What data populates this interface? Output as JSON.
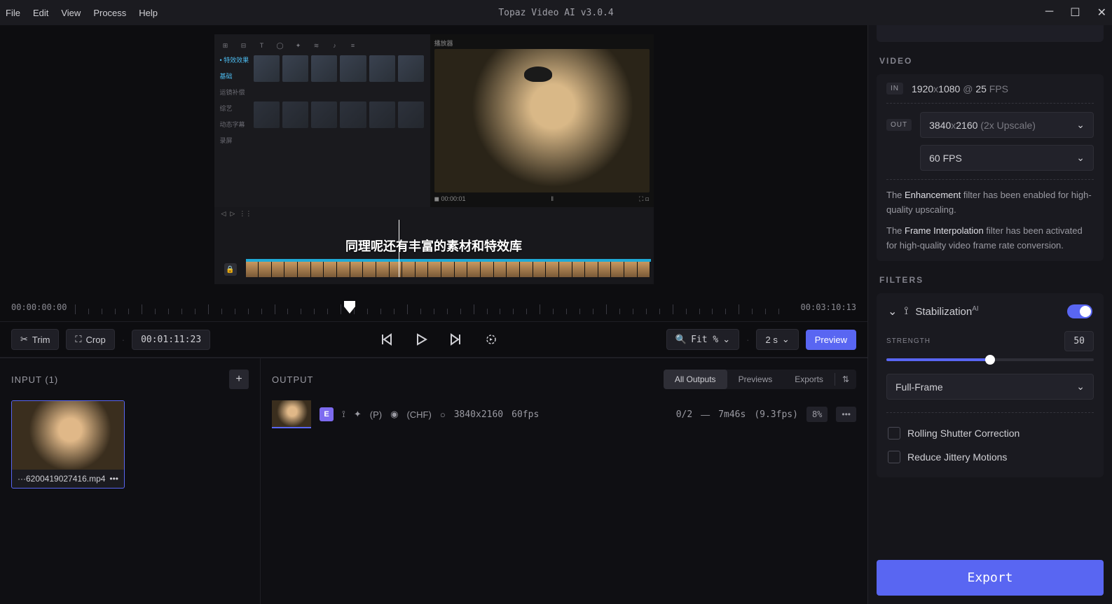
{
  "app": {
    "title": "Topaz Video AI  v3.0.4"
  },
  "menu": [
    "File",
    "Edit",
    "View",
    "Process",
    "Help"
  ],
  "preview": {
    "subtitle": "同理呢还有丰富的素材和特效库"
  },
  "timeline": {
    "start": "00:00:00:00",
    "end": "00:03:10:13",
    "current": "00:01:11:23"
  },
  "toolbar": {
    "trim": "Trim",
    "crop": "Crop",
    "fit": "Fit %",
    "speed": "2 s",
    "preview": "Preview"
  },
  "inputs": {
    "header": "INPUT (1)",
    "file": "···6200419027416.mp4"
  },
  "outputs": {
    "header": "OUTPUT",
    "tabs": [
      "All Outputs",
      "Previews",
      "Exports"
    ],
    "row": {
      "badge": "E",
      "p": "(P)",
      "chf": "(CHF)",
      "res": "3840x2160",
      "fps": "60fps",
      "prog": "0/2",
      "dash": "—",
      "time": "7m46s",
      "rate": "(9.3fps)",
      "pct": "8%"
    }
  },
  "video": {
    "header": "VIDEO",
    "in_tag": "IN",
    "in_res_w": "1920",
    "in_res_sep": "x",
    "in_res_h": "1080",
    "at": "@",
    "in_fps": "25",
    "fps_unit": "FPS",
    "out_tag": "OUT",
    "out_res_w": "3840",
    "out_res_h": "2160",
    "out_scale": "(2x Upscale)",
    "out_fps": "60 FPS",
    "info1_pre": "The ",
    "info1_b": "Enhancement",
    "info1_post": " filter has been enabled for high-quality upscaling.",
    "info2_pre": "The ",
    "info2_b": "Frame Interpolation",
    "info2_post": " filter has been activated for high-quality video frame rate conversion."
  },
  "filters": {
    "header": "FILTERS",
    "stab": "Stabilization",
    "ai": "AI",
    "strength_label": "STRENGTH",
    "strength": "50",
    "mode": "Full-Frame",
    "rolling": "Rolling Shutter Correction",
    "jitter": "Reduce Jittery Motions"
  },
  "export": {
    "label": "Export"
  }
}
